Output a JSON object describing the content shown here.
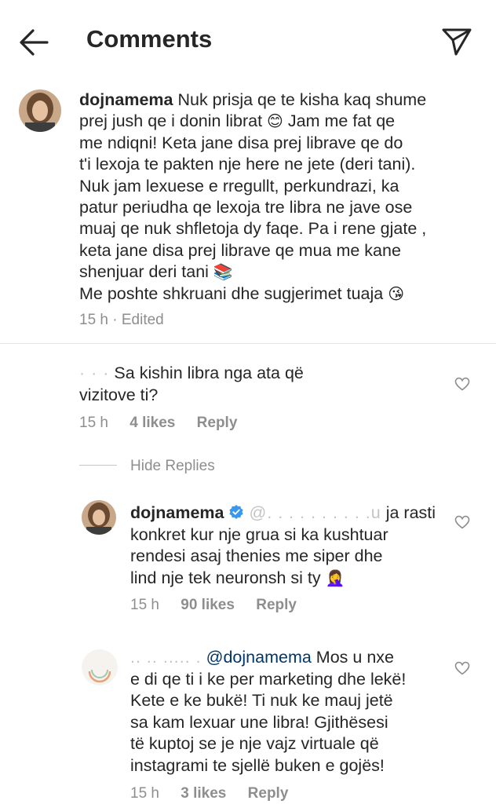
{
  "header": {
    "title": "Comments",
    "back_icon": "arrow-left-icon",
    "send_icon": "paper-plane-icon"
  },
  "caption": {
    "username": "dojnamema",
    "lines": [
      "Nuk prisja qe te kisha kaq shume",
      "prej jush qe i donin librat",
      "Jam me fat qe",
      "me ndiqni! Keta jane disa prej librave qe do",
      "t'i lexoja te pakten nje here ne jete (deri tani).",
      "Nuk jam lexuese e rregullt, perkundrazi, ka",
      "patur periudha qe lexoja tre libra ne jave ose",
      "muaj qe nuk shfletoja dy faqe. Pa i rene gjate ,",
      "keta jane disa prej librave qe mua me kane",
      "shenjuar deri tani",
      "Me poshte shkruani dhe sugjerimet tuaja"
    ],
    "emojis": {
      "smile": "😊",
      "books": "📚",
      "kiss": "😘"
    },
    "time": "15 h",
    "edited": "· Edited"
  },
  "comments": [
    {
      "line1": "Sa kishin libra nga ata që",
      "line2": "vizitove ti?",
      "time": "15 h",
      "likes": "4 likes",
      "reply": "Reply"
    }
  ],
  "hide_replies": "Hide Replies",
  "replies": [
    {
      "username": "dojnamema",
      "redacted_mention": "@. . . . . . . . . .u",
      "line1_tail": "ja rasti",
      "line2": "konkret kur nje grua si ka kushtuar",
      "line3": "rendesi asaj thenies me siper dhe",
      "line4": "lind nje tek neuronsh si ty",
      "emoji": "🤦‍♀️",
      "time": "15 h",
      "likes": "90 likes",
      "reply": "Reply"
    },
    {
      "username_partial": ".. .. ..... .",
      "mention": "@dojnamema",
      "line1_tail": "Mos u nxe",
      "line2": "e di qe ti i ke per marketing dhe lekë!",
      "line3": "Kete e ke bukë! Ti nuk ke mauj jetë",
      "line4": "sa kam lexuar une libra! Gjithësesi",
      "line5": "të kuptoj se je nje vajz virtuale që",
      "line6": "instagrami te sjellë buken e gojës!",
      "time": "15 h",
      "likes": "3 likes",
      "reply": "Reply"
    }
  ],
  "colors": {
    "text": "#262626",
    "meta": "#8e8e8e",
    "verified": "#3897f0",
    "divider": "#e3e3e3"
  }
}
